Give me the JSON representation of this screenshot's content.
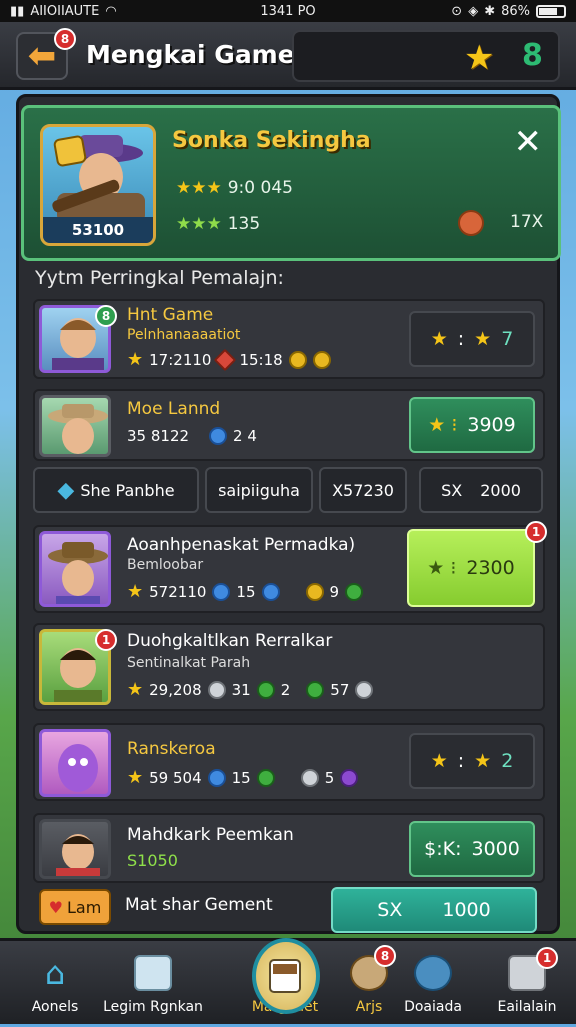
{
  "status": {
    "left": "AIIOIIAUTE",
    "time": "1341 PO",
    "battery": "86%"
  },
  "header": {
    "title": "Mengkai Game",
    "back_badge": "8",
    "green_count": "8"
  },
  "hero": {
    "name": "Sonka Sekingha",
    "tag": "53100",
    "line1": "9:0 045",
    "line2": "135",
    "mult": "17X"
  },
  "section_label": "Yytm Perringkal Pemalajn:",
  "rows": [
    {
      "title": "Hnt Game",
      "sub": "Pelnhanaaaatiot",
      "s1": "17:2110",
      "s2": "15:18",
      "badge": "8",
      "right_left": "★",
      "right_sep": ":",
      "right_val": "7"
    },
    {
      "title": "Moe Lannd",
      "stat_a": "35 8122",
      "stat_b": "2 4",
      "right_label": "3909",
      "right_prefix": "★ ⁝"
    },
    {
      "tab1": "She  Panbhe",
      "tab2": "saipiiguha",
      "tab3": "X57230",
      "tab4_pre": "SX",
      "tab4_val": "2000"
    },
    {
      "title": "Aoanhpenaskat Permadka)",
      "sub": "Bemloobar",
      "s1": "572110",
      "s2": "15",
      "s3": "9",
      "right_prefix": "★ ⁝",
      "right_label": "2300",
      "badge": "1"
    },
    {
      "title": "Duohgkaltlkan Rerralkar",
      "sub": "Sentinalkat Parah",
      "s1": "29,208",
      "s2": "31",
      "s3": "2",
      "s4": "57",
      "badge": "1"
    },
    {
      "title": "Ranskeroa",
      "s1": "59 504",
      "s2": "15",
      "s3": "5",
      "right_val": "2"
    },
    {
      "title": "Mahdkark Peemkan",
      "sub": "S1050",
      "right_prefix": "$:K:",
      "right_label": "3000"
    },
    {
      "lam": "Lam",
      "title": "Mat shar Gement",
      "right_pre": "SX",
      "right_val": "1000"
    }
  ],
  "nav": [
    {
      "label": "Aonels"
    },
    {
      "label": "Legim Rgnkan"
    },
    {
      "label": "Margoaet"
    },
    {
      "label": "Arjs",
      "badge": "8"
    },
    {
      "label": "Doaiada"
    },
    {
      "label": "Eailalain",
      "badge": "1"
    }
  ]
}
